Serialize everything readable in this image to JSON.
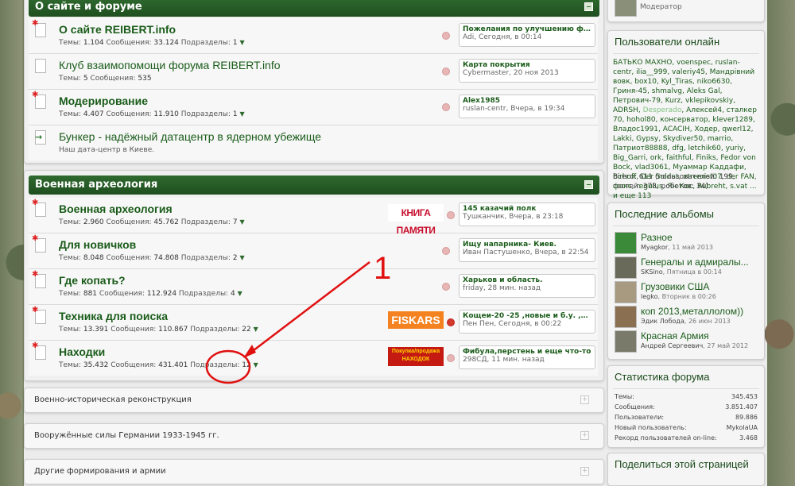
{
  "sections": [
    {
      "title": "О сайте и форуме",
      "forums": [
        {
          "title": "О сайте REIBERT.info",
          "unread": true,
          "stats": {
            "topics_label": "Темы:",
            "topics": "1.104",
            "posts_label": "Сообщения:",
            "posts": "33.124",
            "sub_label": "Подразделы:",
            "sub": "1"
          },
          "last": {
            "title": "Пожелания по улучшению форума",
            "author": "Adi",
            "time": "Сегодня, в 00:14"
          }
        },
        {
          "title": "Клуб взаимопомощи форума REIBERT.info",
          "unread": false,
          "stats": {
            "topics_label": "Темы:",
            "topics": "5",
            "posts_label": "Сообщения:",
            "posts": "535"
          },
          "last": {
            "title": "Карта покрытия",
            "author": "Cybermaster",
            "time": "20 ноя 2013"
          }
        },
        {
          "title": "Модерирование",
          "unread": true,
          "stats": {
            "topics_label": "Темы:",
            "topics": "4.407",
            "posts_label": "Сообщения:",
            "posts": "11.910",
            "sub_label": "Подразделы:",
            "sub": "1"
          },
          "last": {
            "title": "Alex1985",
            "author": "ruslan-centr",
            "time": "Вчера, в 19:34"
          }
        },
        {
          "title": "Бункер - надёжный датацентр в ядерном убежище",
          "link": true,
          "desc": "Наш дата-центр в Киеве."
        }
      ]
    },
    {
      "title": "Военная археология",
      "forums": [
        {
          "title": "Военная археология",
          "stats": {
            "topics_label": "Темы:",
            "topics": "2.960",
            "posts_label": "Сообщения:",
            "posts": "45.762",
            "sub_label": "Подразделы:",
            "sub": "7"
          },
          "ad": "КНИГА ПАМЯТИ",
          "last": {
            "title": "145 казачий полк",
            "author": "Тушканчик",
            "time": "Вчера, в 23:18"
          }
        },
        {
          "title": "Для новичков",
          "stats": {
            "topics_label": "Темы:",
            "topics": "8.048",
            "posts_label": "Сообщения:",
            "posts": "74.808",
            "sub_label": "Подразделы:",
            "sub": "2"
          },
          "last": {
            "title": "Ищу напарника- Киев.",
            "author": "Иван Пастушенко",
            "time": "Вчера, в 22:54"
          }
        },
        {
          "title": "Где копать?",
          "stats": {
            "topics_label": "Темы:",
            "topics": "881",
            "posts_label": "Сообщения:",
            "posts": "112.924",
            "sub_label": "Подразделы:",
            "sub": "4"
          },
          "last": {
            "title": "Харьков и область.",
            "author": "friday",
            "time": "28 мин. назад"
          }
        },
        {
          "title": "Техника для поиска",
          "stats": {
            "topics_label": "Темы:",
            "topics": "13.391",
            "posts_label": "Сообщения:",
            "posts": "110.867",
            "sub_label": "Подразделы:",
            "sub": "22"
          },
          "ad": "FISKARS",
          "last": {
            "title": "Кощеи-20 -25 ,новые и б.у. ,в нали...",
            "author": "Пен Пен",
            "time": "Сегодня, в 00:22"
          }
        },
        {
          "title": "Находки",
          "stats": {
            "topics_label": "Темы:",
            "topics": "35.432",
            "posts_label": "Сообщения:",
            "posts": "431.401",
            "sub_label": "Подразделы:",
            "sub": "12"
          },
          "ad": "Покупка/продажа НАХОДОК",
          "last": {
            "title": "Фибула,перстень и еще что-то",
            "author": "298СД",
            "time": "11 мин. назад"
          }
        }
      ]
    }
  ],
  "collapsed_sections": [
    "Военно-историческая реконструкция",
    "Вооружённые силы Германии 1933-1945 гг.",
    "Другие формирования и армии"
  ],
  "annotation": {
    "number": "1"
  },
  "sidebar": {
    "moderator_label": "Модератор",
    "online": {
      "title": "Пользователи онлайн",
      "users_text": "БАТЬКО МАХНО, voenspec, ruslan-centr, ilia__999, valeriy45, Мандрівний вовк, box10, Kyl_Tiras, niko6630, Гриня-45, shmalvg, Aleks Gal, Петрович-79, Kurz, vklepikovskiy, ADRSH,",
      "desperado": "Desperado",
      "users_text2": ", Алексей4, сталкер 70, hohol80, консерватор, klever1289, Владос1991, ACACIH, Ходер, qwerl12, Lakki, Gypsy, Skydiver50, marrio, Патриот88888, dfg, letchik60, yuriy, Big_Garri, ork, faithful, Finiks, Fedor von Bock, vlad3061, Муаммар Каддафи, birhoff, Der Soldat, xtremist07, der FAN, фокс, regulus, Ян Кос, Rubreht, s.vat ... и еще 113",
      "total": "Всего: 611 (пользователей: 199, гостей: 378, роботов: 34)"
    },
    "albums": {
      "title": "Последние альбомы",
      "items": [
        {
          "name": "Разное",
          "author": "Myagkor",
          "date": "11 май 2013"
        },
        {
          "name": "Генералы и адмиралы...",
          "author": "SKSino",
          "date": "Пятница в 00:14"
        },
        {
          "name": "Грузовики США",
          "author": "legko",
          "date": "Вторник в 00:26"
        },
        {
          "name": "коп 2013,металлолом))",
          "author": "Эдик Лобода",
          "date": "26 июн 2013"
        },
        {
          "name": "Красная Армия",
          "author": "Андрей Сергеевич",
          "date": "27 май 2012"
        }
      ]
    },
    "stats": {
      "title": "Статистика форума",
      "rows": [
        {
          "label": "Темы:",
          "value": "345.453"
        },
        {
          "label": "Сообщения:",
          "value": "3.851.407"
        },
        {
          "label": "Пользователи:",
          "value": "89.886"
        },
        {
          "label": "Новый пользователь:",
          "value": "MykolaUA"
        },
        {
          "label": "Рекорд пользователей on-line:",
          "value": "3.468"
        }
      ]
    },
    "share": {
      "title": "Поделиться этой страницей"
    }
  }
}
